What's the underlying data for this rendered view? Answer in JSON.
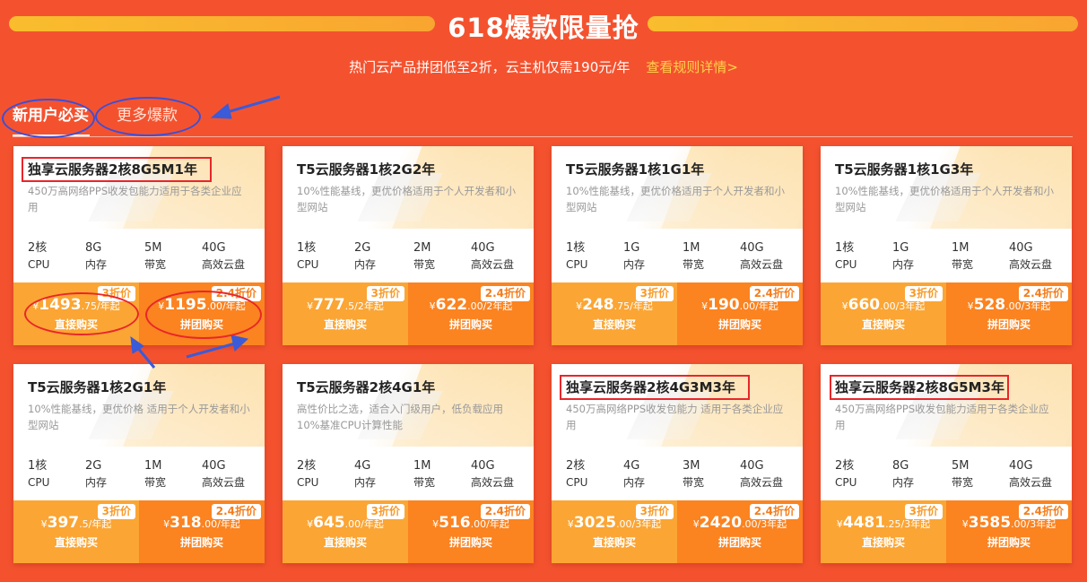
{
  "banner": {
    "title": "618爆款限量抢",
    "subtitle": "热门云产品拼团低至2折，云主机仅需190元/年",
    "rules_link": "查看规则详情>"
  },
  "tabs": [
    {
      "label": "新用户必买",
      "active": true
    },
    {
      "label": "更多爆款",
      "active": false
    }
  ],
  "colors": {
    "background": "#f4522f",
    "direct_buy": "#fba534",
    "group_buy": "#fb8320",
    "annotation_red": "#e8262a",
    "annotation_blue": "#3b4fd8"
  },
  "cards": [
    {
      "title": "独享云服务器2核8G5M1年",
      "desc": "450万高网络PPS收发包能力适用于各类企业应用",
      "specs": [
        {
          "value": "2核",
          "label": "CPU"
        },
        {
          "value": "8G",
          "label": "内存"
        },
        {
          "value": "5M",
          "label": "带宽"
        },
        {
          "value": "40G",
          "label": "高效云盘"
        }
      ],
      "direct": {
        "badge": "3折价",
        "currency": "¥",
        "price_int": "1493",
        "price_rest": ".75/年起",
        "label": "直接购买"
      },
      "group": {
        "badge": "2.4折价",
        "currency": "¥",
        "price_int": "1195",
        "price_rest": ".00/年起",
        "label": "拼团购买"
      }
    },
    {
      "title": "T5云服务器1核2G2年",
      "desc": "10%性能基线，更优价格适用于个人开发者和小型网站",
      "specs": [
        {
          "value": "1核",
          "label": "CPU"
        },
        {
          "value": "2G",
          "label": "内存"
        },
        {
          "value": "2M",
          "label": "带宽"
        },
        {
          "value": "40G",
          "label": "高效云盘"
        }
      ],
      "direct": {
        "badge": "3折价",
        "currency": "¥",
        "price_int": "777",
        "price_rest": ".5/2年起",
        "label": "直接购买"
      },
      "group": {
        "badge": "2.4折价",
        "currency": "¥",
        "price_int": "622",
        "price_rest": ".00/2年起",
        "label": "拼团购买"
      }
    },
    {
      "title": "T5云服务器1核1G1年",
      "desc": "10%性能基线，更优价格适用于个人开发者和小型网站",
      "specs": [
        {
          "value": "1核",
          "label": "CPU"
        },
        {
          "value": "1G",
          "label": "内存"
        },
        {
          "value": "1M",
          "label": "带宽"
        },
        {
          "value": "40G",
          "label": "高效云盘"
        }
      ],
      "direct": {
        "badge": "3折价",
        "currency": "¥",
        "price_int": "248",
        "price_rest": ".75/年起",
        "label": "直接购买"
      },
      "group": {
        "badge": "2.4折价",
        "currency": "¥",
        "price_int": "190",
        "price_rest": ".00/年起",
        "label": "拼团购买"
      }
    },
    {
      "title": "T5云服务器1核1G3年",
      "desc": "10%性能基线，更优价格适用于个人开发者和小型网站",
      "specs": [
        {
          "value": "1核",
          "label": "CPU"
        },
        {
          "value": "1G",
          "label": "内存"
        },
        {
          "value": "1M",
          "label": "带宽"
        },
        {
          "value": "40G",
          "label": "高效云盘"
        }
      ],
      "direct": {
        "badge": "3折价",
        "currency": "¥",
        "price_int": "660",
        "price_rest": ".00/3年起",
        "label": "直接购买"
      },
      "group": {
        "badge": "2.4折价",
        "currency": "¥",
        "price_int": "528",
        "price_rest": ".00/3年起",
        "label": "拼团购买"
      }
    },
    {
      "title": "T5云服务器1核2G1年",
      "desc": "10%性能基线，更优价格 适用于个人开发者和小型网站",
      "specs": [
        {
          "value": "1核",
          "label": "CPU"
        },
        {
          "value": "2G",
          "label": "内存"
        },
        {
          "value": "1M",
          "label": "带宽"
        },
        {
          "value": "40G",
          "label": "高效云盘"
        }
      ],
      "direct": {
        "badge": "3折价",
        "currency": "¥",
        "price_int": "397",
        "price_rest": ".5/年起",
        "label": "直接购买"
      },
      "group": {
        "badge": "2.4折价",
        "currency": "¥",
        "price_int": "318",
        "price_rest": ".00/年起",
        "label": "拼团购买"
      }
    },
    {
      "title": "T5云服务器2核4G1年",
      "desc": "高性价比之选，适合入门级用户，低负载应用 10%基准CPU计算性能",
      "specs": [
        {
          "value": "2核",
          "label": "CPU"
        },
        {
          "value": "4G",
          "label": "内存"
        },
        {
          "value": "1M",
          "label": "带宽"
        },
        {
          "value": "40G",
          "label": "高效云盘"
        }
      ],
      "direct": {
        "badge": "3折价",
        "currency": "¥",
        "price_int": "645",
        "price_rest": ".00/年起",
        "label": "直接购买"
      },
      "group": {
        "badge": "2.4折价",
        "currency": "¥",
        "price_int": "516",
        "price_rest": ".00/年起",
        "label": "拼团购买"
      }
    },
    {
      "title": "独享云服务器2核4G3M3年",
      "desc": "450万高网络PPS收发包能力 适用于各类企业应用",
      "specs": [
        {
          "value": "2核",
          "label": "CPU"
        },
        {
          "value": "4G",
          "label": "内存"
        },
        {
          "value": "3M",
          "label": "带宽"
        },
        {
          "value": "40G",
          "label": "高效云盘"
        }
      ],
      "direct": {
        "badge": "3折价",
        "currency": "¥",
        "price_int": "3025",
        "price_rest": ".00/3年起",
        "label": "直接购买"
      },
      "group": {
        "badge": "2.4折价",
        "currency": "¥",
        "price_int": "2420",
        "price_rest": ".00/3年起",
        "label": "拼团购买"
      }
    },
    {
      "title": "独享云服务器2核8G5M3年",
      "desc": "450万高网络PPS收发包能力适用于各类企业应用",
      "specs": [
        {
          "value": "2核",
          "label": "CPU"
        },
        {
          "value": "8G",
          "label": "内存"
        },
        {
          "value": "5M",
          "label": "带宽"
        },
        {
          "value": "40G",
          "label": "高效云盘"
        }
      ],
      "direct": {
        "badge": "3折价",
        "currency": "¥",
        "price_int": "4481",
        "price_rest": ".25/3年起",
        "label": "直接购买"
      },
      "group": {
        "badge": "2.4折价",
        "currency": "¥",
        "price_int": "3585",
        "price_rest": ".00/3年起",
        "label": "拼团购买"
      }
    }
  ]
}
